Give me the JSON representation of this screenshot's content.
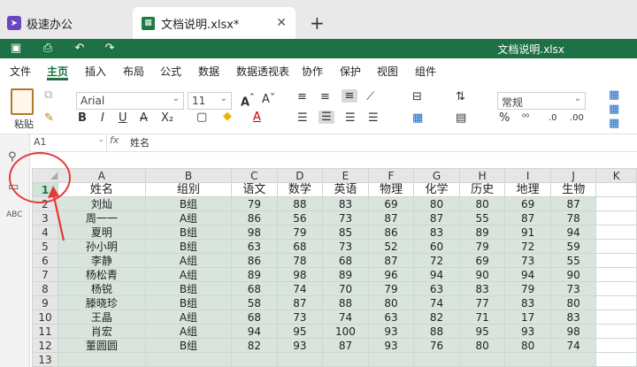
{
  "tabs": {
    "home_label": "极速办公",
    "doc_label": "文档说明.xlsx*"
  },
  "titlebar": {
    "file_name": "文档说明.xlsx"
  },
  "menu": [
    "文件",
    "主页",
    "插入",
    "布局",
    "公式",
    "数据",
    "数据透视表",
    "协作",
    "保护",
    "视图",
    "组件"
  ],
  "ribbon": {
    "paste_label": "粘贴",
    "font_name": "Arial",
    "font_size": "11",
    "number_format": "常规",
    "percent": "%"
  },
  "formula_bar": {
    "cell_ref": "A1",
    "fx": "fx",
    "content": "姓名"
  },
  "sheet": {
    "columns": [
      "A",
      "B",
      "C",
      "D",
      "E",
      "F",
      "G",
      "H",
      "I",
      "J",
      "K"
    ],
    "row_numbers": [
      "1",
      "2",
      "3",
      "4",
      "5",
      "6",
      "7",
      "8",
      "9",
      "10",
      "11",
      "12",
      "13"
    ],
    "headers": [
      "姓名",
      "组别",
      "语文",
      "数学",
      "英语",
      "物理",
      "化学",
      "历史",
      "地理",
      "生物"
    ],
    "rows": [
      [
        "刘灿",
        "B组",
        "79",
        "88",
        "83",
        "69",
        "80",
        "80",
        "69",
        "87"
      ],
      [
        "周一一",
        "A组",
        "86",
        "56",
        "73",
        "87",
        "87",
        "55",
        "87",
        "78"
      ],
      [
        "夏明",
        "B组",
        "98",
        "79",
        "85",
        "86",
        "83",
        "89",
        "91",
        "94"
      ],
      [
        "孙小明",
        "B组",
        "63",
        "68",
        "73",
        "52",
        "60",
        "79",
        "72",
        "59"
      ],
      [
        "李静",
        "A组",
        "86",
        "78",
        "68",
        "87",
        "72",
        "69",
        "73",
        "55"
      ],
      [
        "杨松青",
        "A组",
        "89",
        "98",
        "89",
        "96",
        "94",
        "90",
        "94",
        "90"
      ],
      [
        "杨锐",
        "B组",
        "68",
        "74",
        "70",
        "79",
        "63",
        "83",
        "79",
        "73"
      ],
      [
        "滕晓珍",
        "B组",
        "58",
        "87",
        "88",
        "80",
        "74",
        "77",
        "83",
        "80"
      ],
      [
        "王晶",
        "A组",
        "68",
        "73",
        "74",
        "63",
        "82",
        "71",
        "17",
        "83"
      ],
      [
        "肖宏",
        "A组",
        "94",
        "95",
        "100",
        "93",
        "88",
        "95",
        "93",
        "98"
      ],
      [
        "董圆圆",
        "B组",
        "82",
        "93",
        "87",
        "93",
        "76",
        "80",
        "80",
        "74"
      ],
      [
        "",
        "",
        "",
        "",
        "",
        "",
        "",
        "",
        "",
        ""
      ]
    ]
  }
}
